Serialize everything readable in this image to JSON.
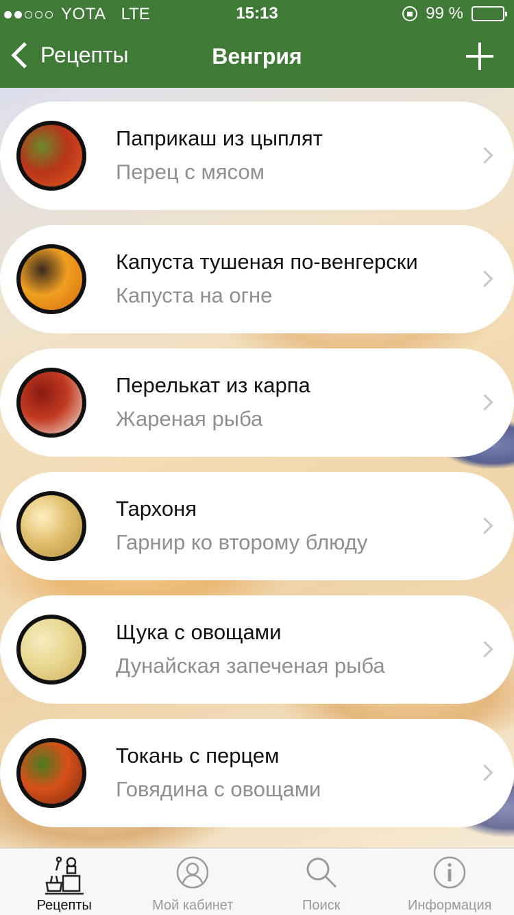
{
  "status_bar": {
    "signal_dots": [
      true,
      true,
      false,
      false,
      false
    ],
    "carrier": "YOTA",
    "network": "LTE",
    "time": "15:13",
    "battery": "99 %",
    "battery_level": 0.99
  },
  "nav": {
    "back_label": "Рецепты",
    "title": "Венгрия",
    "add_icon": "plus-icon"
  },
  "recipes": [
    {
      "title": "Паприкаш из цыплят",
      "subtitle": "Перец с мясом",
      "thumb_colors": [
        "#b8341a",
        "#e25a20",
        "#6b8a2a"
      ]
    },
    {
      "title": "Капуста тушеная по-венгерски",
      "subtitle": "Капуста на огне",
      "thumb_colors": [
        "#f0a020",
        "#d56a10",
        "#3a2a20"
      ]
    },
    {
      "title": "Перелькат из карпа",
      "subtitle": "Жареная рыба",
      "thumb_colors": [
        "#c23a20",
        "#f2e8e0",
        "#8a1a10"
      ]
    },
    {
      "title": "Тархоня",
      "subtitle": "Гарнир ко второму блюду",
      "thumb_colors": [
        "#e0c070",
        "#b8903a",
        "#fff0c0"
      ]
    },
    {
      "title": "Щука с овощами",
      "subtitle": "Дунайская запеченая рыба",
      "thumb_colors": [
        "#e8d890",
        "#d0b060",
        "#f6ecc0"
      ]
    },
    {
      "title": "Токань с перцем",
      "subtitle": "Говядина с овощами",
      "thumb_colors": [
        "#d8501a",
        "#7a2a10",
        "#4a7a20"
      ]
    }
  ],
  "tabs": [
    {
      "label": "Рецепты",
      "icon": "chef-icon",
      "active": true
    },
    {
      "label": "Мой кабинет",
      "icon": "user-icon",
      "active": false
    },
    {
      "label": "Поиск",
      "icon": "search-icon",
      "active": false
    },
    {
      "label": "Информация",
      "icon": "info-icon",
      "active": false
    }
  ],
  "colors": {
    "primary_green": "#3f7a37",
    "card_bg": "#ffffff",
    "subtitle_gray": "#8f8f8f"
  }
}
